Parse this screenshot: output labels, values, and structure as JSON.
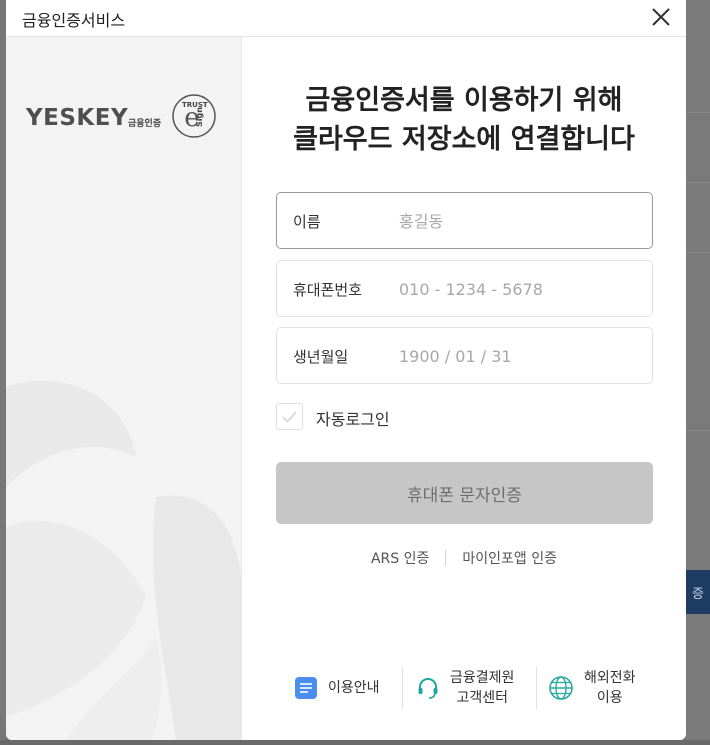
{
  "window": {
    "title": "금융인증서비스"
  },
  "brand": {
    "wordmark": "YESKEY",
    "sub": "금융인증",
    "seal_top": "TRUST",
    "seal_letter": "e",
    "seal_side": "Sign"
  },
  "headline": {
    "line1": "금융인증서를 이용하기 위해",
    "line2": "클라우드 저장소에 연결합니다"
  },
  "form": {
    "name": {
      "label": "이름",
      "placeholder": "홍길동",
      "value": ""
    },
    "phone": {
      "label": "휴대폰번호",
      "placeholder": "010 - 1234 - 5678",
      "value": ""
    },
    "birth": {
      "label": "생년월일",
      "placeholder": "1900 / 01 / 31",
      "value": ""
    },
    "autologin": {
      "label": "자동로그인",
      "checked": false
    },
    "submit_label": "휴대폰 문자인증"
  },
  "alt_auth": [
    "ARS 인증",
    "마이인포앱 인증"
  ],
  "footer": {
    "guide": "이용안내",
    "support_line1": "금융결제원",
    "support_line2": "고객센터",
    "overseas_line1": "해외전화",
    "overseas_line2": "이용"
  },
  "background": {
    "button_fragment": "증"
  },
  "colors": {
    "submit_disabled_bg": "#c6c6c6",
    "guide_icon": "#4a8ef0",
    "support_icon": "#1ea7a0",
    "globe_icon": "#2aa9a0"
  }
}
